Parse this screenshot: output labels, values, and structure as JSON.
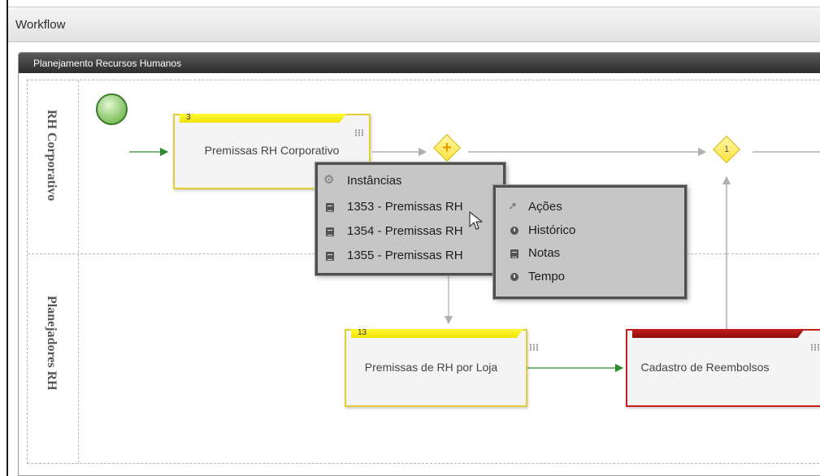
{
  "window": {
    "title": "Workflow"
  },
  "panel": {
    "title": "Planejamento Recursos Humanos"
  },
  "lanes": [
    {
      "label": "RH Corporativo"
    },
    {
      "label": "Planejadores RH"
    }
  ],
  "tasks": {
    "premissas_corporativo": {
      "badge": "3",
      "label": "Premissas RH Corporativo"
    },
    "premissas_loja": {
      "badge": "13",
      "label": "Premissas de RH por Loja"
    },
    "cadastro_reembolsos": {
      "badge": "",
      "label": "Cadastro de Reembolsos"
    }
  },
  "gateways": {
    "parallel": {
      "symbol": "+"
    },
    "counter": {
      "label": "1"
    }
  },
  "instances_menu": {
    "header": {
      "icon": "gear-icon",
      "label": "Instâncias"
    },
    "items": [
      {
        "icon": "document-icon",
        "label": "1353 - Premissas RH"
      },
      {
        "icon": "document-icon",
        "label": "1354 - Premissas RH"
      },
      {
        "icon": "document-icon",
        "label": "1355 - Premissas RH"
      }
    ]
  },
  "actions_menu": {
    "items": [
      {
        "icon": "wrench-icon",
        "label": "Ações"
      },
      {
        "icon": "clock-icon",
        "label": "Histórico"
      },
      {
        "icon": "document-icon",
        "label": "Notas"
      },
      {
        "icon": "clock-icon",
        "label": "Tempo"
      }
    ]
  },
  "colors": {
    "start_event": "#7fc062",
    "task_border": "#e5cc34",
    "task_ribbon": "#f0e000",
    "task_alert": "#c41f1f",
    "gateway_fill": "#ffe33d",
    "flow_green": "#2e8b2e",
    "flow_gray": "#a0a0a0"
  }
}
